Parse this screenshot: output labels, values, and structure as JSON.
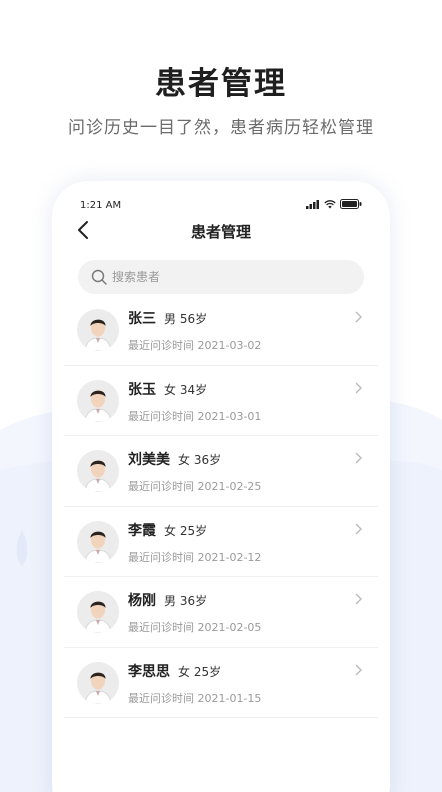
{
  "headline": "患者管理",
  "subline": "问诊历史一目了然，患者病历轻松管理",
  "status": {
    "time": "1:21 AM"
  },
  "nav": {
    "title": "患者管理"
  },
  "search": {
    "placeholder": "搜索患者"
  },
  "patients": [
    {
      "name": "张三",
      "gender_age": "男 56岁",
      "last_visit": "最近问诊时间 2021-03-02"
    },
    {
      "name": "张玉",
      "gender_age": "女 34岁",
      "last_visit": "最近问诊时间 2021-03-01"
    },
    {
      "name": "刘美美",
      "gender_age": "女 36岁",
      "last_visit": "最近问诊时间 2021-02-25"
    },
    {
      "name": "李霞",
      "gender_age": "女 25岁",
      "last_visit": "最近问诊时间 2021-02-12"
    },
    {
      "name": "杨刚",
      "gender_age": "男 36岁",
      "last_visit": "最近问诊时间 2021-02-05"
    },
    {
      "name": "李思思",
      "gender_age": "女 25岁",
      "last_visit": "最近问诊时间 2021-01-15"
    }
  ],
  "icons": {
    "back": "chevron-left-icon",
    "search": "search-icon",
    "row_arrow": "chevron-right-icon",
    "signal": "signal-icon",
    "wifi": "wifi-icon",
    "battery": "battery-icon"
  },
  "colors": {
    "accent_bg": "#e9effb",
    "text_primary": "#222222",
    "text_secondary": "#9a9a9a"
  }
}
